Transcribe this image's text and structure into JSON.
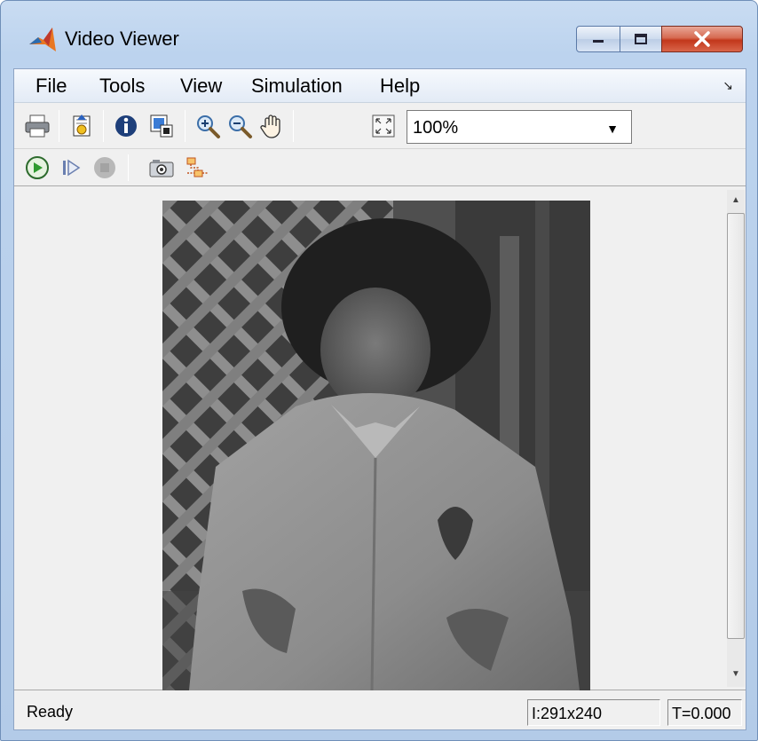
{
  "window": {
    "title": "Video Viewer",
    "icon": "matlab-icon",
    "caption_buttons": [
      "minimize-icon",
      "maximize-icon",
      "close-icon"
    ]
  },
  "menu": {
    "items": [
      "File",
      "Tools",
      "View",
      "Simulation",
      "Help"
    ],
    "overflow_icon": "menu-overflow-arrow-icon"
  },
  "toolbar1": {
    "icons": [
      "print-icon",
      "export-to-image-tool-icon",
      "video-information-icon",
      "pixel-region-icon",
      "zoom-in-icon",
      "zoom-out-icon",
      "pan-hand-icon",
      "fit-to-view-icon"
    ],
    "zoom": {
      "value": "100%",
      "options_visible": [
        "100%"
      ]
    }
  },
  "toolbar2": {
    "icons": [
      "start-simulation-icon",
      "step-forward-icon",
      "stop-icon",
      "snapshot-camera-icon",
      "highlight-simulink-signal-icon"
    ]
  },
  "viewer": {
    "content": "grayscale video frame"
  },
  "status": {
    "text": "Ready",
    "image_size": "I:291x240",
    "time": "T=0.000"
  },
  "colors": {
    "frame_blue": "#b9d1ea",
    "close_red": "#c8442a",
    "play_green": "#2f9a2f"
  }
}
